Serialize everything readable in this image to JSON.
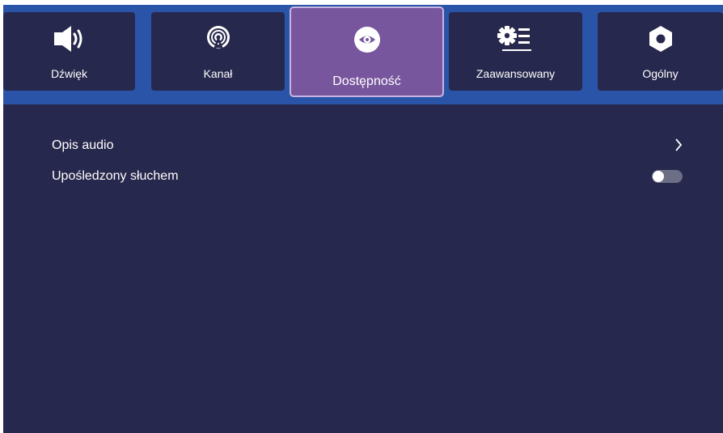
{
  "tabs": [
    {
      "label": "Dźwięk",
      "icon": "speaker-icon"
    },
    {
      "label": "Kanał",
      "icon": "antenna-icon"
    },
    {
      "label": "Dostępność",
      "icon": "eye-icon",
      "active": true
    },
    {
      "label": "Zaawansowany",
      "icon": "advanced-settings-icon"
    },
    {
      "label": "Ogólny",
      "icon": "gear-icon"
    }
  ],
  "settings": {
    "audio_description": {
      "label": "Opis audio",
      "icon": "chevron-right-icon"
    },
    "hearing_impaired": {
      "label": "Upośledzony słuchem",
      "toggle_on": false
    }
  },
  "colors": {
    "background": "#27284d",
    "tab_bar": "#2a54a8",
    "active_tab": "#77569e",
    "toggle_off": "#6b6e85"
  }
}
